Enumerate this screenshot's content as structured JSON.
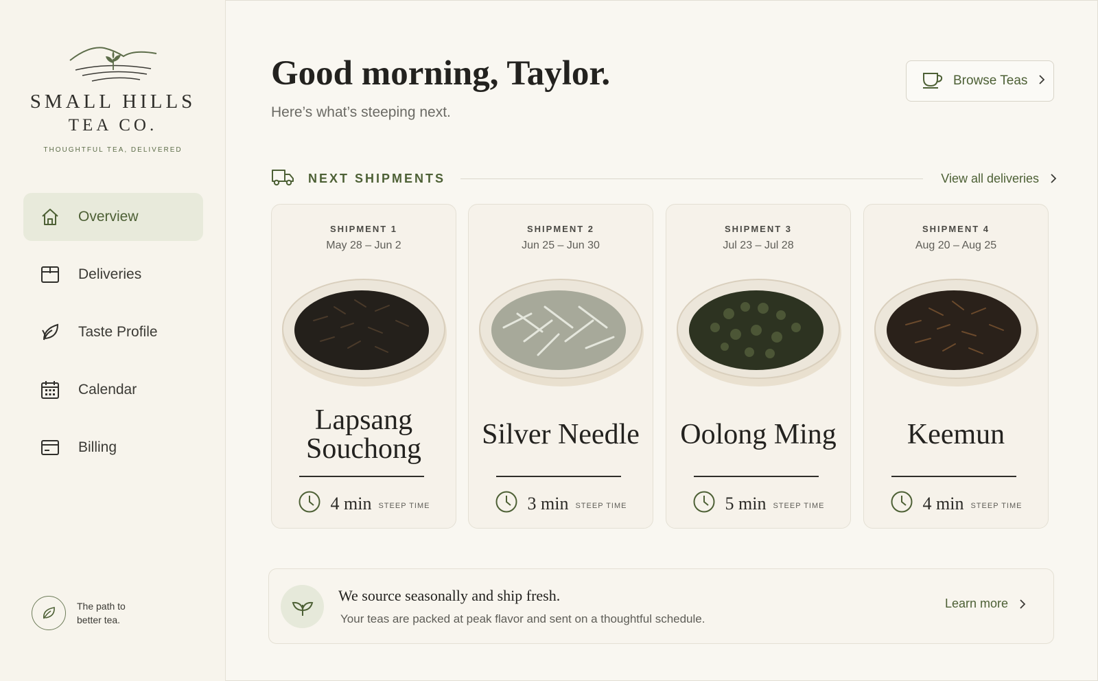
{
  "brand": {
    "name_line1": "SMALL HILLS",
    "name_line2": "TEA CO.",
    "tagline": "THOUGHTFUL TEA, DELIVERED"
  },
  "sidebar": {
    "items": [
      {
        "label": "Overview",
        "icon": "home-icon",
        "active": true
      },
      {
        "label": "Deliveries",
        "icon": "box-icon",
        "active": false
      },
      {
        "label": "Taste Profile",
        "icon": "leaf-icon",
        "active": false
      },
      {
        "label": "Calendar",
        "icon": "calendar-icon",
        "active": false
      },
      {
        "label": "Billing",
        "icon": "card-icon",
        "active": false
      }
    ],
    "footer_text": "The path to better tea."
  },
  "header": {
    "greeting": "Good morning, Taylor.",
    "subtitle": "Here’s what’s steeping next.",
    "browse_label": "Browse Teas"
  },
  "shipments": {
    "title": "NEXT SHIPMENTS",
    "view_all": "View all deliveries",
    "steep_label": "STEEP TIME",
    "items": [
      {
        "label": "SHIPMENT 1",
        "dates": "May 28 – Jun 2",
        "name": "Lapsang Souchong",
        "steep": "4 min"
      },
      {
        "label": "SHIPMENT 2",
        "dates": "Jun 25 – Jun 30",
        "name": "Silver Needle",
        "steep": "3 min"
      },
      {
        "label": "SHIPMENT 3",
        "dates": "Jul 23 – Jul 28",
        "name": "Oolong Ming",
        "steep": "5 min"
      },
      {
        "label": "SHIPMENT 4",
        "dates": "Aug 20 – Aug 25",
        "name": "Keemun",
        "steep": "4 min"
      }
    ]
  },
  "banner": {
    "title": "We source seasonally and ship fresh.",
    "body": "Your teas are packed at peak flavor and sent on a thoughtful schedule.",
    "link": "Learn more"
  },
  "colors": {
    "accent": "#4d6035",
    "background": "#f9f7f1",
    "active_nav": "#e8eadb"
  }
}
